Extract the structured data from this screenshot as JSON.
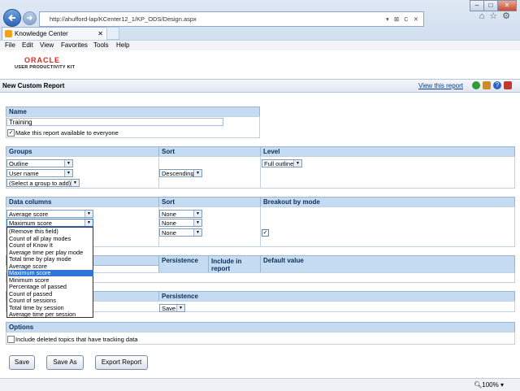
{
  "browser": {
    "url": "http://ahufford-lap/KCenter12_1/KP_ODS/Design.aspx",
    "tab_title": "Knowledge Center",
    "address_tools": "▾ ⊠ C ✕",
    "menu": [
      "File",
      "Edit",
      "View",
      "Favorites",
      "Tools",
      "Help"
    ],
    "zoom": "100%"
  },
  "brand": {
    "oracle": "ORACLE",
    "product": "USER PRODUCTIVITY KIT"
  },
  "page": {
    "title": "New Custom Report",
    "view_link": "View this report"
  },
  "name_section": {
    "header": "Name",
    "value": "Training",
    "available_label": "Make this report available to everyone",
    "available_checked": true
  },
  "groups_section": {
    "headers": {
      "groups": "Groups",
      "sort": "Sort",
      "level": "Level"
    },
    "rows": [
      {
        "group": "Outline",
        "sort": "",
        "level": "Full outline"
      },
      {
        "group": "User name",
        "sort": "Descending",
        "level": ""
      },
      {
        "group": "(Select a group to add)",
        "sort": "",
        "level": ""
      }
    ]
  },
  "data_section": {
    "headers": {
      "columns": "Data columns",
      "sort": "Sort",
      "breakout": "Breakout by mode"
    },
    "rows": [
      {
        "column": "Average score",
        "sort": "None"
      },
      {
        "column": "Maximum score",
        "sort": "None"
      },
      {
        "column": "",
        "sort": "None",
        "breakout_checked": true
      }
    ]
  },
  "dropdown": {
    "options": [
      "(Remove this field)",
      "Count of all play modes",
      "Count of Know It",
      "Average time per play mode",
      "Total time by play mode",
      "Average score",
      "Maximum score",
      "Minimum score",
      "Percentage of passed",
      "Count of passed",
      "Count of sessions",
      "Total time by session",
      "Average time per session"
    ],
    "selected": "Maximum score"
  },
  "filter_section": {
    "headers": {
      "persistence": "Persistence",
      "include": "Include in report",
      "default": "Default value"
    }
  },
  "persist_section": {
    "headers": {
      "persistence": "Persistence"
    },
    "value": "Save"
  },
  "options_section": {
    "header": "Options",
    "deleted_label": "Include deleted topics that have tracking data",
    "deleted_checked": false
  },
  "buttons": {
    "save": "Save",
    "save_as": "Save As",
    "export": "Export Report"
  },
  "colors": {
    "header_bg": "#c5dbf1",
    "selection": "#3074d6",
    "brand_red": "#e0261c"
  }
}
